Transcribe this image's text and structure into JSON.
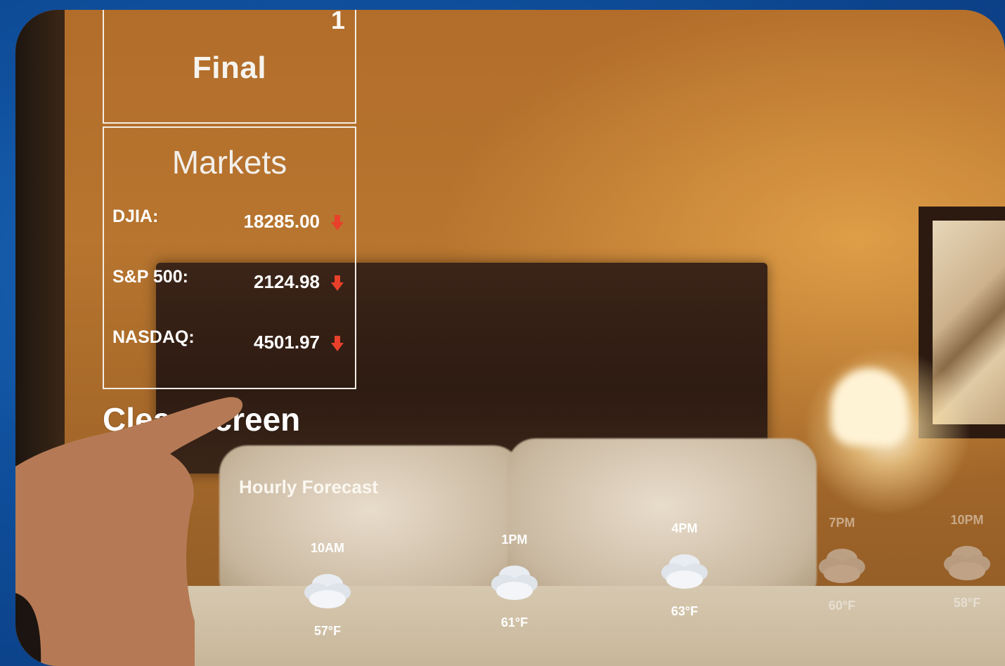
{
  "scoreboard": {
    "digit": "1",
    "status": "Final"
  },
  "markets": {
    "title": "Markets",
    "rows": [
      {
        "name": "DJIA:",
        "value": "18285.00",
        "trend": "down"
      },
      {
        "name": "S&P 500:",
        "value": "2124.98",
        "trend": "down"
      },
      {
        "name": "NASDAQ:",
        "value": "4501.97",
        "trend": "down"
      }
    ]
  },
  "clear_screen": {
    "label": "Clear Screen"
  },
  "forecast": {
    "title": "Hourly Forecast",
    "hours": [
      {
        "time": "10AM",
        "temp": "57°F",
        "icon": "cloud-icon"
      },
      {
        "time": "1PM",
        "temp": "61°F",
        "icon": "cloud-icon"
      },
      {
        "time": "4PM",
        "temp": "63°F",
        "icon": "cloud-icon"
      },
      {
        "time": "7PM",
        "temp": "60°F",
        "icon": "cloud-icon"
      },
      {
        "time": "10PM",
        "temp": "58°F",
        "icon": "cloud-icon"
      }
    ]
  },
  "colors": {
    "background": "#0f4f9c",
    "arrow_down": "#e8402a",
    "panel_border": "#f3ece4"
  }
}
